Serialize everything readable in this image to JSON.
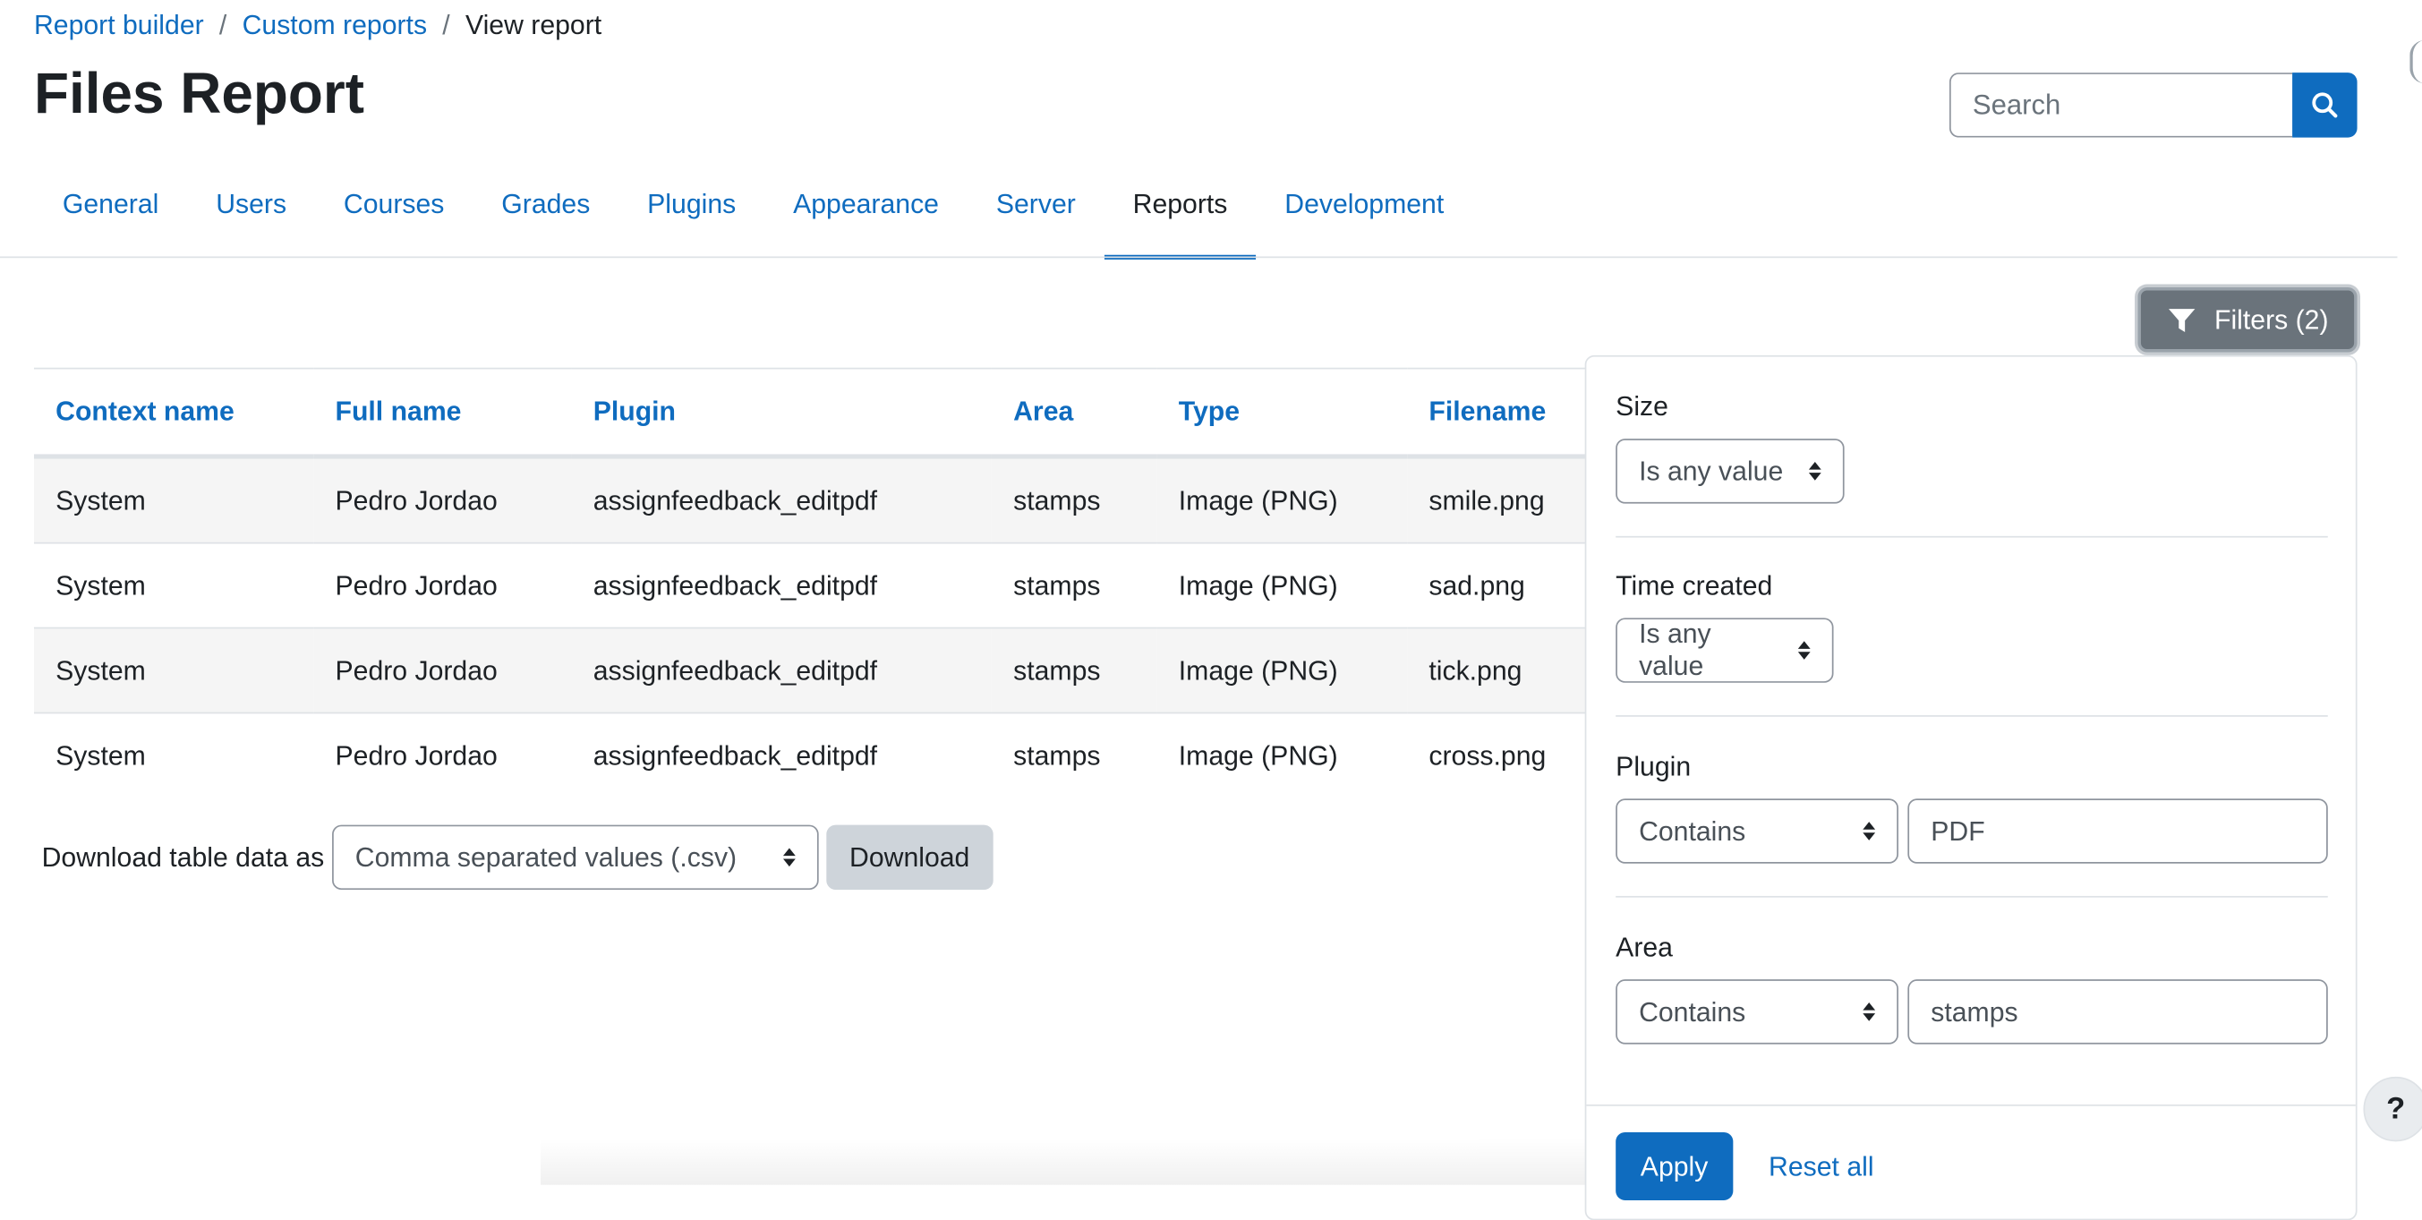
{
  "breadcrumb": {
    "items": [
      "Report builder",
      "Custom reports"
    ],
    "current": "View report"
  },
  "page": {
    "title": "Files Report"
  },
  "search": {
    "placeholder": "Search"
  },
  "nav": {
    "tabs": [
      "General",
      "Users",
      "Courses",
      "Grades",
      "Plugins",
      "Appearance",
      "Server",
      "Reports",
      "Development"
    ],
    "active": "Reports"
  },
  "filters_button": {
    "label": "Filters (2)"
  },
  "table": {
    "headers": [
      "Context name",
      "Full name",
      "Plugin",
      "Area",
      "Type",
      "Filename"
    ],
    "rows": [
      [
        "System",
        "Pedro Jordao",
        "assignfeedback_editpdf",
        "stamps",
        "Image (PNG)",
        "smile.png"
      ],
      [
        "System",
        "Pedro Jordao",
        "assignfeedback_editpdf",
        "stamps",
        "Image (PNG)",
        "sad.png"
      ],
      [
        "System",
        "Pedro Jordao",
        "assignfeedback_editpdf",
        "stamps",
        "Image (PNG)",
        "tick.png"
      ],
      [
        "System",
        "Pedro Jordao",
        "assignfeedback_editpdf",
        "stamps",
        "Image (PNG)",
        "cross.png"
      ]
    ]
  },
  "download": {
    "label": "Download table data as",
    "format": "Comma separated values (.csv)",
    "button": "Download"
  },
  "filters_panel": {
    "size": {
      "label": "Size",
      "operator": "Is any value"
    },
    "time_created": {
      "label": "Time created",
      "operator": "Is any value"
    },
    "plugin": {
      "label": "Plugin",
      "operator": "Contains",
      "value": "PDF"
    },
    "area": {
      "label": "Area",
      "operator": "Contains",
      "value": "stamps"
    },
    "apply": "Apply",
    "reset": "Reset all"
  },
  "help": {
    "label": "?"
  },
  "colors": {
    "primary": "#0f6cbf",
    "secondary": "#6a737b",
    "text": "#1d2125",
    "border": "#dee2e6"
  }
}
